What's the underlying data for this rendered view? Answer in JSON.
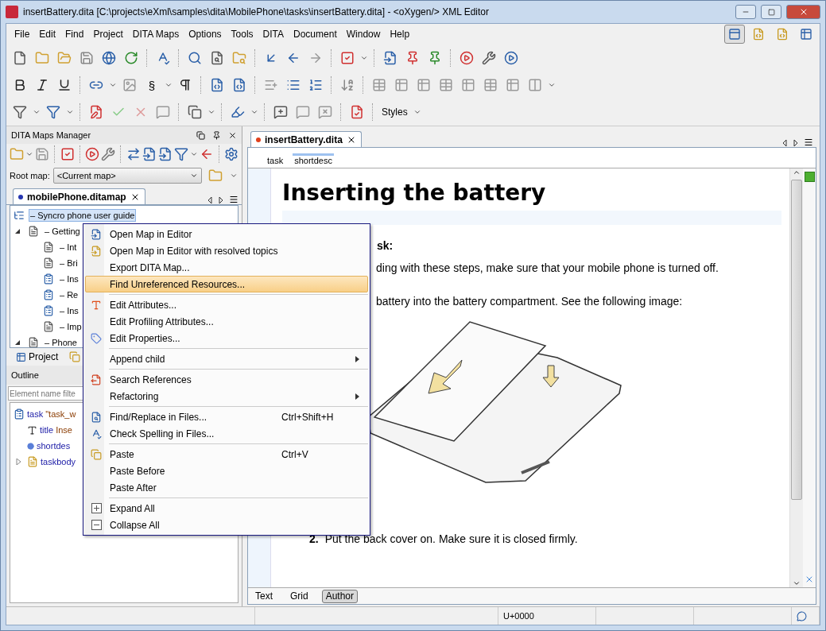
{
  "window": {
    "title": "insertBattery.dita [C:\\projects\\eXml\\samples\\dita\\MobilePhone\\tasks\\insertBattery.dita] - <oXygen/> XML Editor"
  },
  "menu_bar": [
    "File",
    "Edit",
    "Find",
    "Project",
    "DITA Maps",
    "Options",
    "Tools",
    "DITA",
    "Document",
    "Window",
    "Help"
  ],
  "toolbar": {
    "section_glyph": "§",
    "styles_label": "Styles"
  },
  "maps_manager": {
    "title": "DITA Maps Manager",
    "root_map_label": "Root map:",
    "root_map_value": "<Current map>",
    "tab": {
      "label": "mobilePhone.ditamap",
      "modified": false
    },
    "tree": [
      {
        "label": "– Syncro phone user guide",
        "kind": "map",
        "selected": true,
        "children": [
          {
            "label": "– Getting",
            "kind": "topic",
            "expanded": true,
            "selected": false,
            "children": [
              {
                "label": "– Int",
                "kind": "topic",
                "selected": false
              },
              {
                "label": "– Bri",
                "kind": "topic",
                "selected": false
              },
              {
                "label": "– Ins",
                "kind": "task",
                "selected": false
              },
              {
                "label": "– Re",
                "kind": "task",
                "selected": false
              },
              {
                "label": "– Ins",
                "kind": "task",
                "selected": false
              },
              {
                "label": "– Imp",
                "kind": "topic",
                "selected": false
              }
            ]
          },
          {
            "label": "– Phone",
            "kind": "topic",
            "expanded": true,
            "selected": false
          }
        ]
      }
    ]
  },
  "panel_tabs": [
    {
      "label": "Project",
      "selected": false
    }
  ],
  "outline": {
    "title": "Outline",
    "filter_placeholder": "Element name filte",
    "items": [
      {
        "name": "task",
        "detail": "\"task_w",
        "kind": "task",
        "children": [
          {
            "name": "title",
            "detail": "Inse",
            "kind": "title"
          },
          {
            "name": "shortdes",
            "kind": "shortdesc"
          },
          {
            "name": "taskbody",
            "kind": "taskbody",
            "expanded": false
          }
        ]
      }
    ]
  },
  "editor": {
    "tab": {
      "label": "insertBattery.dita",
      "modified": true
    },
    "breadcrumb": [
      {
        "label": "task",
        "selected": false
      },
      {
        "label": "shortdesc",
        "selected": true
      }
    ],
    "title": "Inserting the battery",
    "context_heading": "sk:",
    "context_text": "ding with these steps, make sure that your mobile phone is turned off.",
    "step_text": "battery into the battery compartment. See the following image:",
    "step2": {
      "number": "2.",
      "text": "Put the back cover on. Make sure it is closed firmly."
    },
    "view_modes": [
      {
        "label": "Text",
        "selected": false
      },
      {
        "label": "Grid",
        "selected": false
      },
      {
        "label": "Author",
        "selected": true
      }
    ]
  },
  "context_menu": [
    [
      {
        "label": "Open Map in Editor",
        "selected": false
      },
      {
        "label": "Open Map in Editor with resolved topics",
        "selected": false
      },
      {
        "label": "Export DITA Map...",
        "selected": false
      },
      {
        "label": "Find Unreferenced Resources...",
        "selected": true
      }
    ],
    [
      {
        "label": "Edit Attributes...",
        "selected": false
      },
      {
        "label": "Edit Profiling Attributes...",
        "selected": false
      },
      {
        "label": "Edit Properties...",
        "selected": false
      }
    ],
    [
      {
        "label": "Append child",
        "selected": false,
        "submenu": true
      }
    ],
    [
      {
        "label": "Search References",
        "selected": false
      },
      {
        "label": "Refactoring",
        "selected": false,
        "submenu": true
      }
    ],
    [
      {
        "label": "Find/Replace in Files...",
        "shortcut": "Ctrl+Shift+H",
        "selected": false
      },
      {
        "label": "Check Spelling in Files...",
        "selected": false
      }
    ],
    [
      {
        "label": "Paste",
        "shortcut": "Ctrl+V",
        "selected": false
      },
      {
        "label": "Paste Before",
        "selected": false
      },
      {
        "label": "Paste After",
        "selected": false
      }
    ],
    [
      {
        "label": "Expand All",
        "selected": false
      },
      {
        "label": "Collapse All",
        "selected": false
      }
    ]
  ],
  "status_bar": {
    "encoding": "U+0000"
  }
}
